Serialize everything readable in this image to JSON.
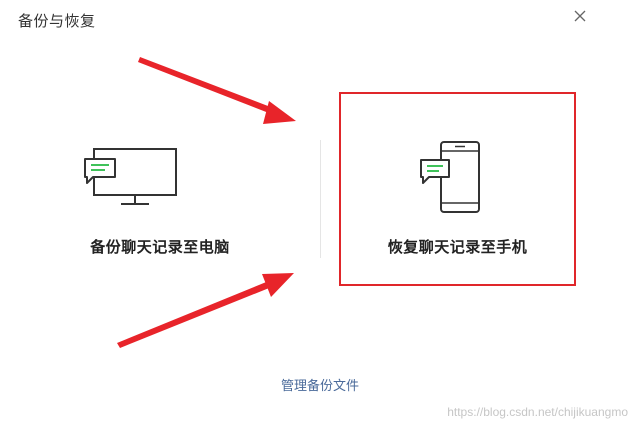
{
  "window": {
    "title": "备份与恢复"
  },
  "options": {
    "backup_label": "备份聊天记录至电脑",
    "restore_label": "恢复聊天记录至手机"
  },
  "footer": {
    "manage_link": "管理备份文件"
  },
  "watermark": "https://blog.csdn.net/chijikuangmo",
  "colors": {
    "accent_green": "#3fc25a",
    "highlight_red": "#e0262a",
    "link_blue": "#4a6a9a"
  },
  "icons": {
    "close": "close-icon",
    "computer": "computer-icon",
    "phone": "phone-icon",
    "chat": "chat-bubble-icon"
  }
}
